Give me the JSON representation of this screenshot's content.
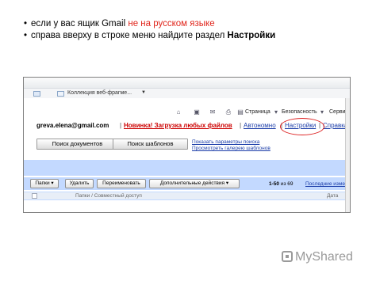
{
  "instructions": {
    "line1_prefix": "если у вас ящик Gmail ",
    "line1_red": "не на русском языке",
    "line2_prefix": "справа вверху в строке меню найдите раздел ",
    "line2_bold": "Настройки"
  },
  "screenshot": {
    "tab_label": "Коллекция веб-фрагме...",
    "toolbar": {
      "page": "Страница",
      "security": "Безопасность",
      "service": "Сервис"
    },
    "account": {
      "email": "greva.elena@gmail.com",
      "new_feature": "Новинка! Загрузка любых файлов",
      "offline": "Автономно",
      "settings": "Настройки",
      "help": "Справка",
      "separator": "|"
    },
    "search": {
      "docs_button": "Поиск документов",
      "templates_button": "Поиск шаблонов",
      "show_options": "Показать параметры поиска",
      "gallery": "Просмотреть галерею шаблонов"
    },
    "actions": {
      "folders": "Папки",
      "delete": "Удалить",
      "rename": "Переименовать",
      "more": "Дополнительные действия",
      "page_range": "1-50",
      "page_of": "из 69",
      "newer": "Последние изме"
    },
    "folder_row": {
      "path": "Папки / Совместный доступ",
      "date": "Дата"
    }
  },
  "watermark": {
    "brand": "MyShared"
  },
  "colors": {
    "accent_red": "#e0251b",
    "gmail_blue": "#c3d9ff",
    "link_blue": "#1a3ca8"
  }
}
